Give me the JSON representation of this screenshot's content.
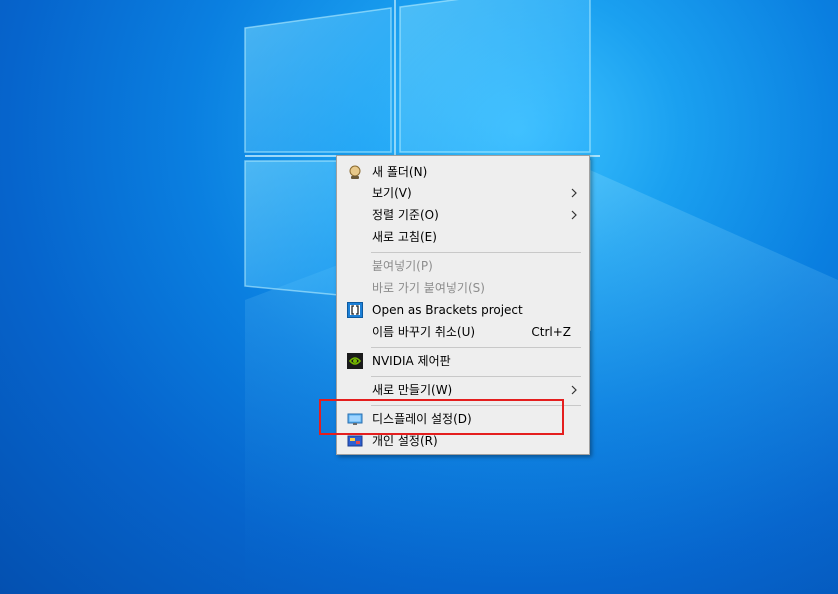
{
  "desktop": {
    "background_color": "#0a7fe0",
    "logo_icon": "windows-logo"
  },
  "context_menu": {
    "items": [
      {
        "label": "새 폴더(N)",
        "icon": "folder-icon",
        "disabled": false
      },
      {
        "label": "보기(V)",
        "submenu": true,
        "disabled": false
      },
      {
        "label": "정렬 기준(O)",
        "submenu": true,
        "disabled": false
      },
      {
        "label": "새로 고침(E)",
        "disabled": false
      },
      {
        "label": "붙여넣기(P)",
        "disabled": true
      },
      {
        "label": "바로 가기 붙여넣기(S)",
        "disabled": true
      },
      {
        "label": "Open as Brackets project",
        "icon": "brackets-icon",
        "disabled": false
      },
      {
        "label": "이름 바꾸기 취소(U)",
        "shortcut": "Ctrl+Z",
        "disabled": false
      },
      {
        "label": "NVIDIA 제어판",
        "icon": "nvidia-icon",
        "disabled": false
      },
      {
        "label": "새로 만들기(W)",
        "submenu": true,
        "disabled": false
      },
      {
        "label": "디스플레이 설정(D)",
        "icon": "display-icon",
        "disabled": false
      },
      {
        "label": "개인 설정(R)",
        "icon": "personalize-icon",
        "disabled": false
      }
    ]
  },
  "annotation": {
    "highlight_color": "#e41e1e",
    "highlighted_item": "디스플레이 설정(D)"
  }
}
